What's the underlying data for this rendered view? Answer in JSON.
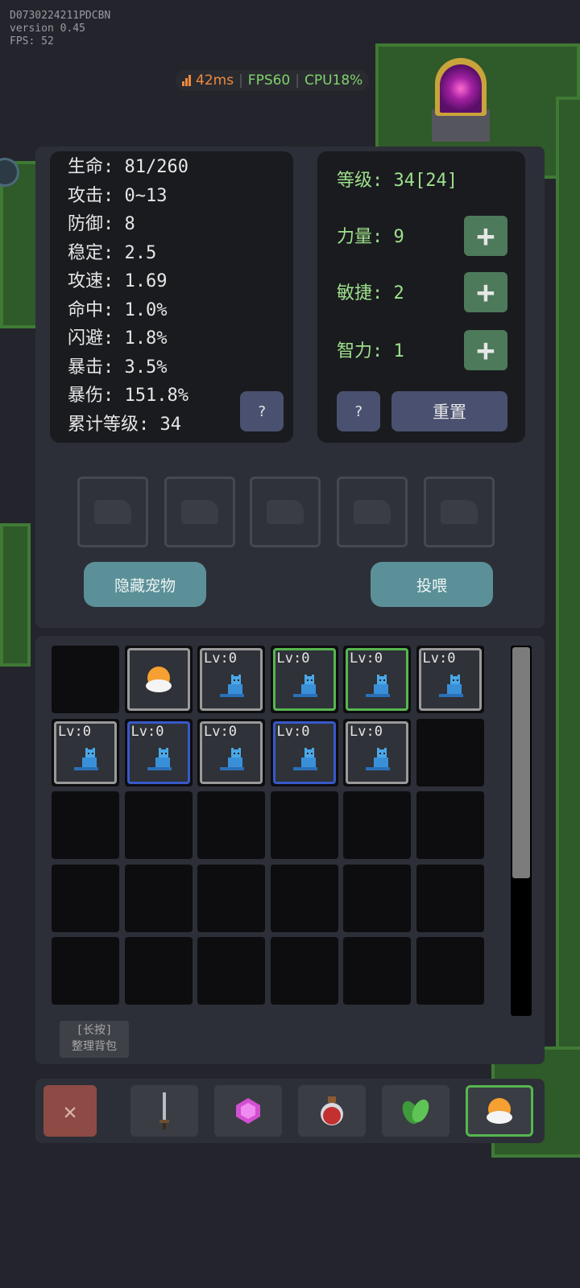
{
  "debug": {
    "id": "D0730224211PDCBN",
    "version": "version 0.45",
    "fps": "FPS: 52"
  },
  "perf": {
    "ping": "42ms",
    "fps": "FPS60",
    "cpu": "CPU18%",
    "ping_color": "#f08a3c",
    "fps_color": "#7fd36b"
  },
  "stats": [
    "生命: 81/260",
    "攻击: 0~13",
    "防御: 8",
    "稳定: 2.5",
    "攻速: 1.69",
    "命中: 1.0%",
    "闪避: 1.8%",
    "暴击: 3.5%",
    "暴伤: 151.8%",
    "累计等级: 34"
  ],
  "stats_help": "?",
  "attributes": {
    "level": "等级: 34[24]",
    "strength": "力量: 9",
    "agility": "敏捷: 2",
    "intellect": "智力: 1",
    "plus": "+",
    "help": "?",
    "reset": "重置"
  },
  "pets": {
    "hide_button": "隐藏宠物",
    "feed_button": "投喂"
  },
  "inventory": {
    "items": [
      {
        "type": "empty"
      },
      {
        "type": "egg",
        "label": ""
      },
      {
        "type": "pet",
        "label": "Lv:0",
        "rarity": "gray"
      },
      {
        "type": "pet",
        "label": "Lv:0",
        "rarity": "green"
      },
      {
        "type": "pet",
        "label": "Lv:0",
        "rarity": "green"
      },
      {
        "type": "pet",
        "label": "Lv:0",
        "rarity": "gray"
      },
      {
        "type": "pet",
        "label": "Lv:0",
        "rarity": "gray"
      },
      {
        "type": "pet",
        "label": "Lv:0",
        "rarity": "blue"
      },
      {
        "type": "pet",
        "label": "Lv:0",
        "rarity": "gray"
      },
      {
        "type": "pet",
        "label": "Lv:0",
        "rarity": "blue"
      },
      {
        "type": "pet",
        "label": "Lv:0",
        "rarity": "gray"
      }
    ],
    "sort_hint_line1": "[长按]",
    "sort_hint_line2": "整理背包",
    "scroll_fraction": 0.63
  },
  "toolbar": {
    "close": "✕",
    "tabs": [
      "sword-icon",
      "gem-icon",
      "potion-icon",
      "leaf-icon",
      "egg-icon"
    ],
    "selected_tab": 4
  }
}
